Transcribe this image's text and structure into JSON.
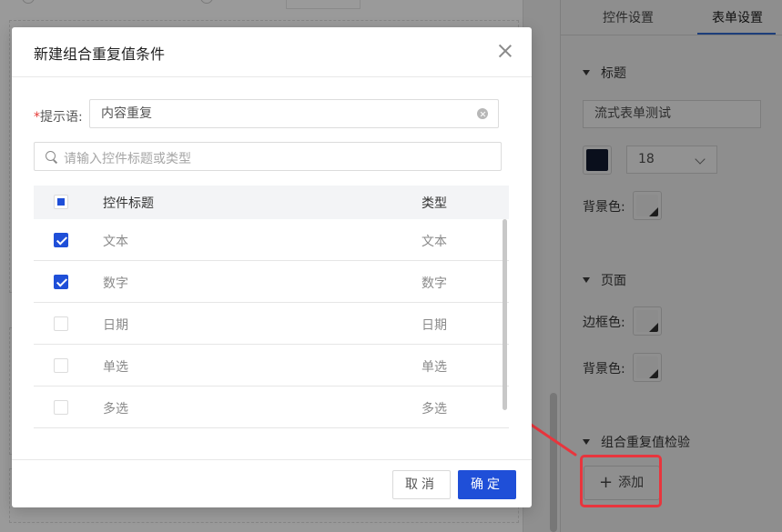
{
  "panel": {
    "tabs": [
      {
        "label": "控件设置",
        "active": false
      },
      {
        "label": "表单设置",
        "active": true
      }
    ],
    "sections": {
      "title": {
        "heading": "标题",
        "value": "流式表单测试",
        "font_color": "#0a0f1c",
        "font_size": "18",
        "bg_label": "背景色:"
      },
      "page": {
        "heading": "页面",
        "border_label": "边框色:",
        "bg_label": "背景色:"
      },
      "combo": {
        "heading": "组合重复值检验",
        "add_label": "添加"
      }
    }
  },
  "modal": {
    "title": "新建组合重复值条件",
    "prompt_required_mark": "*",
    "prompt_label": "提示语:",
    "prompt_value": "内容重复",
    "search_placeholder": "请输入控件标题或类型",
    "table": {
      "headers": {
        "title": "控件标题",
        "type": "类型"
      },
      "rows": [
        {
          "title": "文本",
          "type": "文本",
          "checked": true
        },
        {
          "title": "数字",
          "type": "数字",
          "checked": true
        },
        {
          "title": "日期",
          "type": "日期",
          "checked": false
        },
        {
          "title": "单选",
          "type": "单选",
          "checked": false
        },
        {
          "title": "多选",
          "type": "多选",
          "checked": false
        }
      ]
    },
    "footer": {
      "cancel": "取消",
      "ok": "确定"
    }
  },
  "colors": {
    "primary": "#1f4fd8",
    "highlight": "#e8353d",
    "required": "#e53935"
  }
}
